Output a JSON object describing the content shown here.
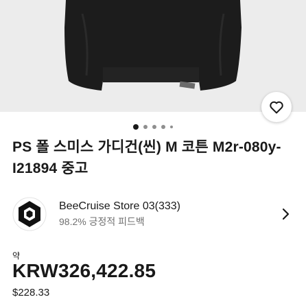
{
  "listing": {
    "image_alt": "Black cardigan",
    "favorite_icon": "heart-outline-icon",
    "carousel": {
      "total_dots": 5,
      "active_index": 0
    },
    "title": "PS 폴 스미스 가디건(씬) M 코튼 M2r-080y-I21894 중고"
  },
  "seller": {
    "logo_icon": "hexagon-logo-icon",
    "name": "BeeCruise Store 03(333)",
    "feedback": "98.2% 긍정적 피드백",
    "chevron_icon": "chevron-right-icon"
  },
  "price": {
    "approx_label": "약",
    "amount": "KRW326,422.85",
    "original": "$228.33"
  },
  "colors": {
    "background": "#ffffff",
    "text": "#191919",
    "secondary": "#707070",
    "hero_bg": "#ececec"
  }
}
